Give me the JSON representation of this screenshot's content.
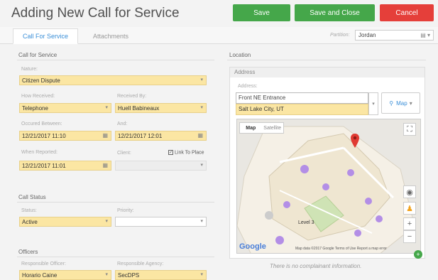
{
  "page": {
    "title": "Adding New Call for Service"
  },
  "toolbar": {
    "save": "Save",
    "save_close": "Save and Close",
    "cancel": "Cancel"
  },
  "tabs": [
    {
      "label": "Call For Service"
    },
    {
      "label": "Attachments"
    }
  ],
  "partition": {
    "label": "Partition:",
    "value": "Jordan"
  },
  "call_for_service": {
    "heading": "Call for Service",
    "nature": {
      "label": "Nature:",
      "value": "Citizen Dispute"
    },
    "how_received": {
      "label": "How Received:",
      "value": "Telephone"
    },
    "received_by": {
      "label": "Received By:",
      "value": "Huell Babineaux"
    },
    "occurred_between": {
      "label": "Occured Between:",
      "value": "12/21/2017 11:10"
    },
    "and": {
      "label": "And:",
      "value": "12/21/2017 12:01"
    },
    "when_reported": {
      "label": "When Reported:",
      "value": "12/21/2017 11:01"
    },
    "client": {
      "label": "Client:"
    },
    "link_to_place": "Link To Place"
  },
  "call_status": {
    "heading": "Call Status",
    "status": {
      "label": "Status:",
      "value": "Active"
    },
    "priority": {
      "label": "Priority:"
    }
  },
  "officers": {
    "heading": "Officers",
    "officer": {
      "label": "Responsible Officer:",
      "value": "Horario Caine"
    },
    "agency": {
      "label": "Responsible Agency:",
      "value": "SecDPS"
    }
  },
  "location": {
    "heading": "Location",
    "address_header": "Address",
    "address_label": "Address:",
    "address_line1": "Front NE Entrance",
    "address_line2": "Salt Lake City, UT",
    "map_button": "Map"
  },
  "map": {
    "type_map": "Map",
    "type_satellite": "Satellite",
    "level": "Level 3",
    "google": "Google",
    "attribution": "Map data ©2017 Google   Terms of Use   Report a map error"
  },
  "complainant": {
    "empty": "There is no complainant information."
  },
  "colors": {
    "green": "#45a74a",
    "red": "#e53f3a",
    "accent": "#3a8fd8",
    "field_yellow": "#fbe6a3"
  }
}
